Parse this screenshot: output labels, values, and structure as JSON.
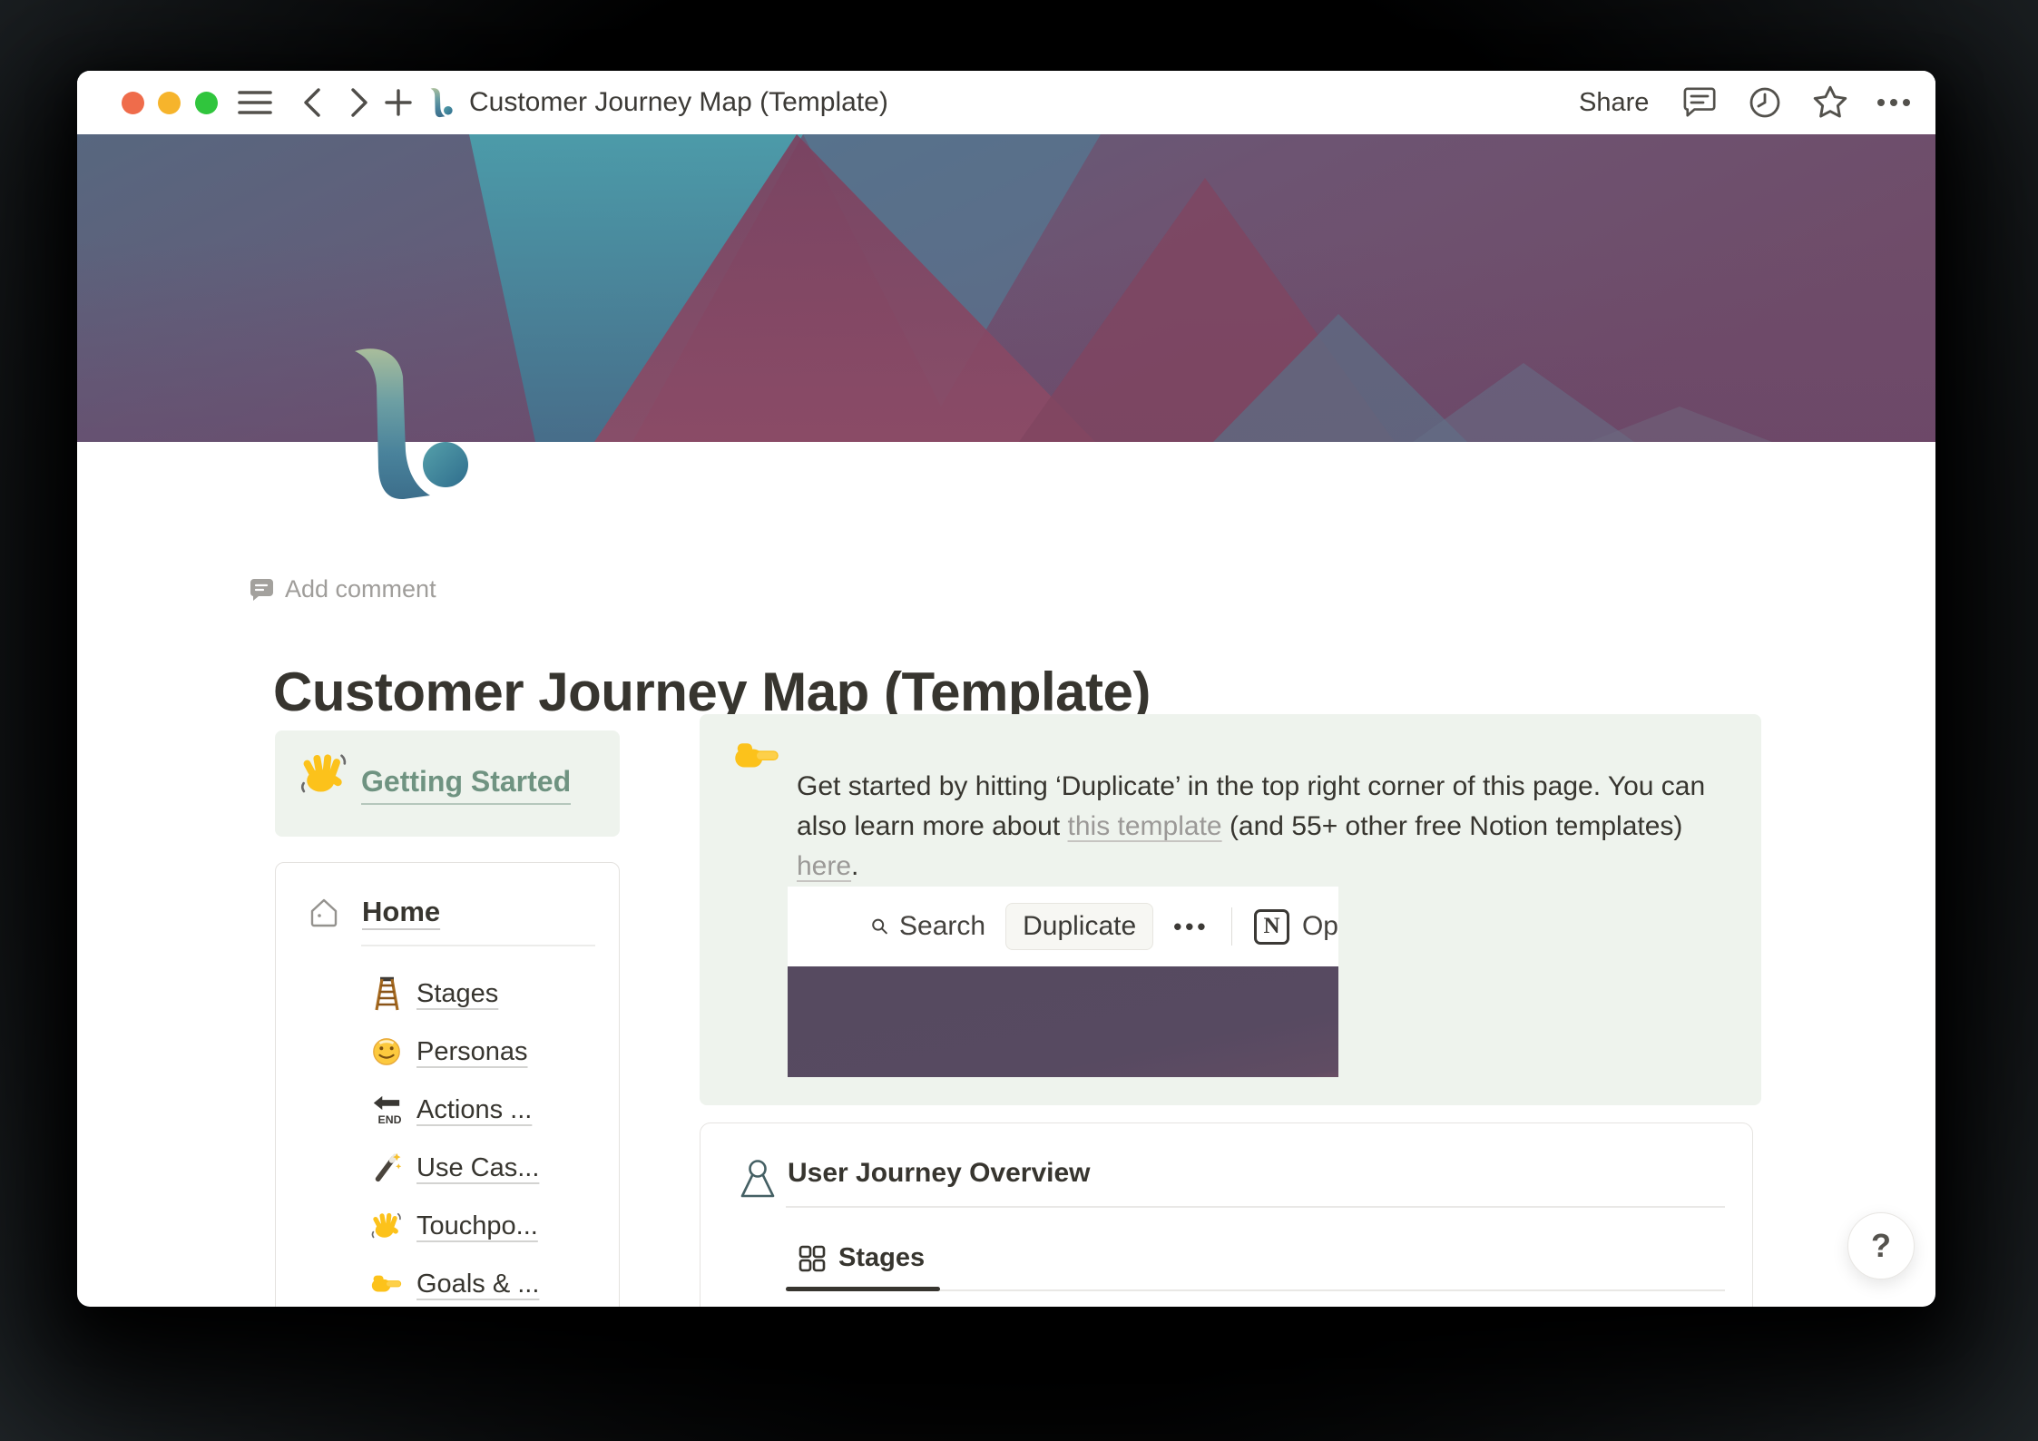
{
  "titlebar": {
    "title": "Customer Journey Map (Template)",
    "share_label": "Share"
  },
  "page": {
    "add_comment_label": "Add comment",
    "title": "Customer Journey Map (Template)"
  },
  "sidebar": {
    "getting_started": {
      "emoji": "👋",
      "icon": "waving-hand-emoji",
      "label": "Getting Started"
    },
    "home_label": "Home",
    "items": [
      {
        "emoji": "🪜",
        "icon": "ladder-emoji",
        "label": "Stages"
      },
      {
        "emoji": "🙂",
        "icon": "smiley-emoji",
        "label": "Personas"
      },
      {
        "emoji": "🔚",
        "icon": "end-arrow-emoji",
        "label": "Actions ..."
      },
      {
        "emoji": "🪄",
        "icon": "magic-wand-emoji",
        "label": "Use Cas..."
      },
      {
        "emoji": "👋",
        "icon": "waving-hand-emoji",
        "label": "Touchpo..."
      },
      {
        "emoji": "👉",
        "icon": "pointing-right-emoji",
        "label": "Goals & ..."
      }
    ]
  },
  "callout": {
    "emoji": "👉",
    "segments": [
      {
        "text": "Get started by hitting ‘Duplicate’ in the top right corner of this page. You can\nalso learn more about "
      },
      {
        "text": "this template",
        "link": true
      },
      {
        "text": " (and 55+ other free Notion templates) "
      },
      {
        "text": "here",
        "link": true
      },
      {
        "text": "."
      }
    ],
    "screenshot": {
      "search_label": "Search",
      "duplicate_label": "Duplicate",
      "more_label": "•••",
      "notion_letter": "N",
      "open_label": "Op"
    }
  },
  "overview": {
    "title": "User Journey Overview",
    "tabs": [
      {
        "label": "Stages",
        "active": true
      }
    ]
  },
  "help": {
    "label": "?"
  },
  "colors": {
    "text_primary": "#37352f",
    "text_muted": "#9f9d9a",
    "link_gray": "#9b9997",
    "green_text": "#6f9381",
    "green_bg": "#eef3ed",
    "screenshot_purple": "#564a60",
    "banner_slate": "#57677f",
    "banner_purple": "#6f4c69",
    "banner_teal": "#4aa0ad",
    "traffic_red": "#ef6c4b",
    "traffic_yellow": "#f6b42c",
    "traffic_green": "#30c53d"
  }
}
